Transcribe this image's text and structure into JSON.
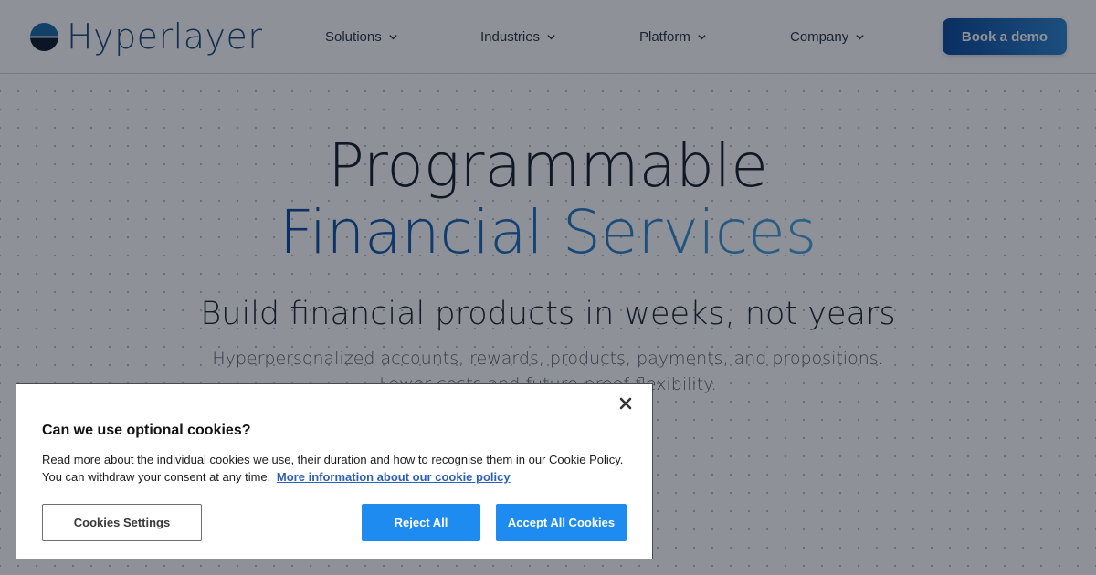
{
  "header": {
    "logo_text": "Hyperlayer",
    "nav": [
      {
        "label": "Solutions",
        "icon": "chevron-down-icon"
      },
      {
        "label": "Industries",
        "icon": "chevron-down-icon"
      },
      {
        "label": "Platform",
        "icon": "chevron-down-icon"
      },
      {
        "label": "Company",
        "icon": "chevron-down-icon"
      }
    ],
    "cta_label": "Book a demo"
  },
  "hero": {
    "title_line1": "Programmable",
    "title_line2": "Financial Services",
    "subtitle": "Build financial products in weeks, not years",
    "description_line1": "Hyperpersonalized accounts, rewards, products, payments, and propositions.",
    "description_line2": "Lower costs and future-proof flexibility."
  },
  "cookie_banner": {
    "title": "Can we use optional cookies?",
    "body": "Read more about the individual cookies we use, their duration and how to recognise them in our Cookie Policy. You can withdraw your consent at any time.",
    "link_text": "More information about our cookie policy",
    "settings_label": "Cookies Settings",
    "reject_label": "Reject All",
    "accept_label": "Accept All Cookies",
    "close_icon": "close-icon"
  },
  "colors": {
    "brand_navy": "#1a4b7c",
    "gradient_start": "#0d4aa0",
    "gradient_end": "#4ba8e0",
    "cookie_button_blue": "#1e8bf0",
    "link_blue": "#2c5fb8"
  }
}
